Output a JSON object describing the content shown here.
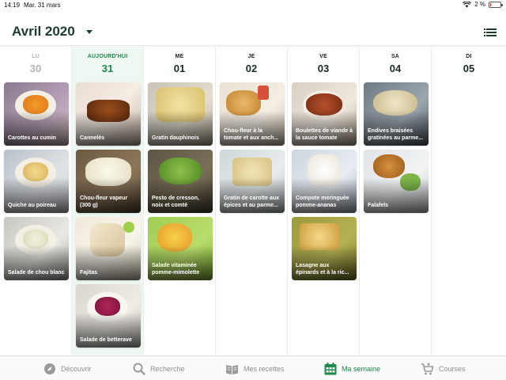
{
  "status": {
    "time": "14:19",
    "date": "Mar. 31 mars",
    "battery": "2 %"
  },
  "header": {
    "month": "Avril 2020"
  },
  "days": [
    {
      "name": "LU",
      "num": "30"
    },
    {
      "name": "AUJOURD'HUI",
      "num": "31"
    },
    {
      "name": "ME",
      "num": "01"
    },
    {
      "name": "JE",
      "num": "02"
    },
    {
      "name": "VE",
      "num": "03"
    },
    {
      "name": "SA",
      "num": "04"
    },
    {
      "name": "DI",
      "num": "05"
    }
  ],
  "recipes": {
    "lu": [
      "Carottes au cumin",
      "Quiche au poireau",
      "Salade de chou blanc"
    ],
    "ma": [
      "Cannelés",
      "Chou-fleur vapeur (300 g)",
      "Fajitas",
      "Salade de betterave"
    ],
    "me": [
      "Gratin dauphinois",
      "Pesto de cresson, noix et comté",
      "Salade vitaminée pomme-mimolette"
    ],
    "je": [
      "Chou-fleur à la tomate et aux anch...",
      "Gratin de carotte aux épices et au parme..."
    ],
    "ve": [
      "Boulettes de viande à la sauce tomate",
      "Compote meringuée pomme-ananas",
      "Lasagne aux épinards et à la ric..."
    ],
    "sa": [
      "Endives braisées gratinées au parme...",
      "Falafels"
    ]
  },
  "tabs": [
    "Découvrir",
    "Recherche",
    "Mes recettes",
    "Ma semaine",
    "Courses"
  ],
  "colors": {
    "accent": "#1f8a4c",
    "heading": "#1f3b2c"
  }
}
